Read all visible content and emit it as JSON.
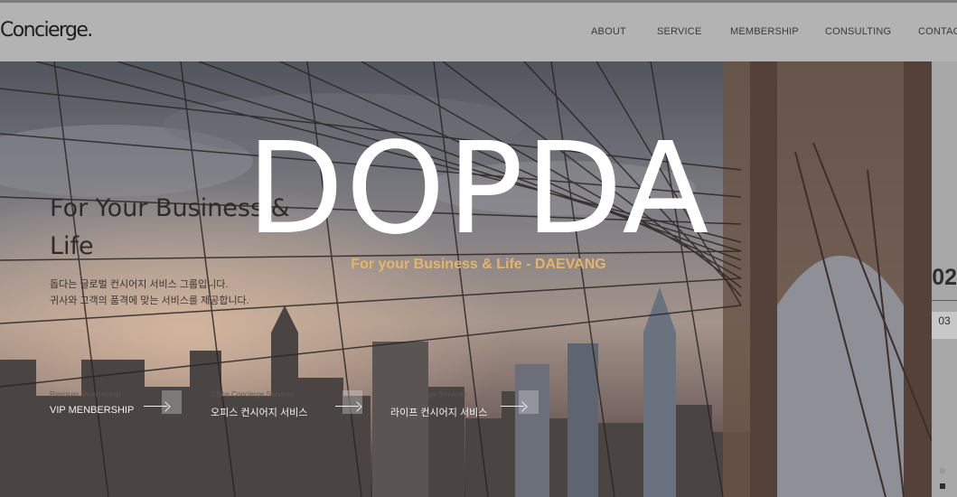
{
  "header": {
    "logo": "Concierge.",
    "nav": [
      {
        "label": "ABOUT"
      },
      {
        "label": "SERVICE"
      },
      {
        "label": "MEMBERSHIP"
      },
      {
        "label": "CONSULTING"
      },
      {
        "label": "CONTACT"
      }
    ]
  },
  "hero": {
    "headline": "DOPDA",
    "subheadline": "For your Business & Life - DAEVANG",
    "tagline": "For Your Business & Life",
    "description_line1": "돕다는 글로벌 컨시어지 서비스 그룹입니다.",
    "description_line2": "귀사와 고객의 품격에 맞는 서비스를 제공합니다.",
    "services": [
      {
        "small": "Premium Membership",
        "label": "VIP MENBERSHIP"
      },
      {
        "small": "Office Concierge Services",
        "label": "오피스 컨시어지 서비스"
      },
      {
        "small": "Life Concierge Services",
        "label": "라이프 컨시어지 서비스"
      }
    ],
    "counter": {
      "current": "02",
      "next": "03"
    }
  },
  "colors": {
    "headline": "#ffffff",
    "subheadline": "#e5b567",
    "header_bg": "#b3b3b3"
  },
  "icons": [
    "arrow-right-icon",
    "slide-dot-icon"
  ]
}
